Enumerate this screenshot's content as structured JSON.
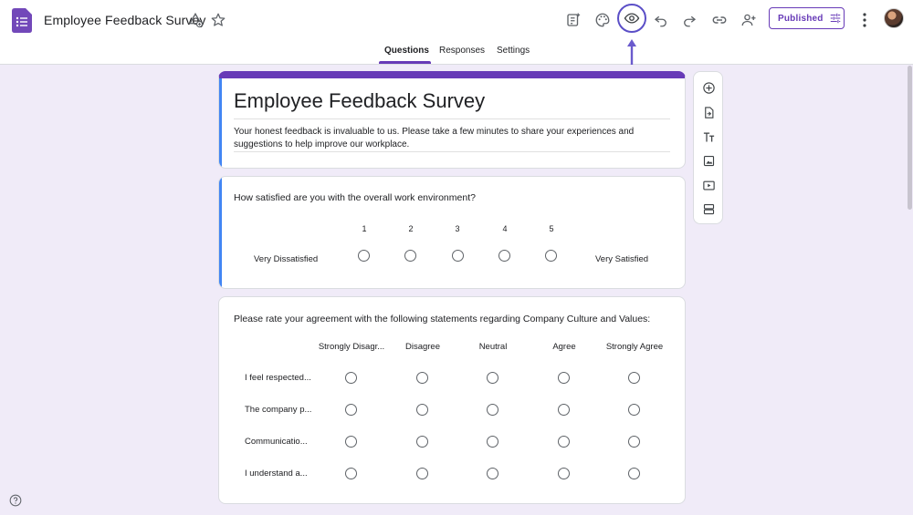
{
  "header": {
    "title": "Employee Feedback Survey",
    "publish_label": "Published",
    "accent_color": "#673ab7",
    "icons": [
      "forms-logo-icon",
      "drive-move-icon",
      "star-icon",
      "addon-icon",
      "palette-icon",
      "preview-eye-icon",
      "undo-icon",
      "redo-icon",
      "link-icon",
      "add-collaborator-icon",
      "publish-settings-icon",
      "more-vert-icon"
    ]
  },
  "tabs": [
    {
      "label": "Questions",
      "active": true
    },
    {
      "label": "Responses",
      "active": false
    },
    {
      "label": "Settings",
      "active": false
    }
  ],
  "form": {
    "title": "Employee Feedback Survey",
    "description": "Your honest feedback is invaluable to us. Please take a few minutes to share your experiences and suggestions to help improve our workplace."
  },
  "q1": {
    "question": "How satisfied are you with the overall work environment?",
    "scale": [
      "1",
      "2",
      "3",
      "4",
      "5"
    ],
    "low_label": "Very Dissatisfied",
    "high_label": "Very Satisfied"
  },
  "q2": {
    "question": "Please rate your agreement with the following statements regarding Company Culture and Values:",
    "columns": [
      "Strongly Disagr...",
      "Disagree",
      "Neutral",
      "Agree",
      "Strongly Agree"
    ],
    "rows": [
      "I feel respected...",
      "The company p...",
      "Communicatio...",
      "I understand a..."
    ]
  },
  "toolbar": [
    "add-question-icon",
    "import-questions-icon",
    "add-title-icon",
    "add-image-icon",
    "add-video-icon",
    "add-section-icon"
  ]
}
